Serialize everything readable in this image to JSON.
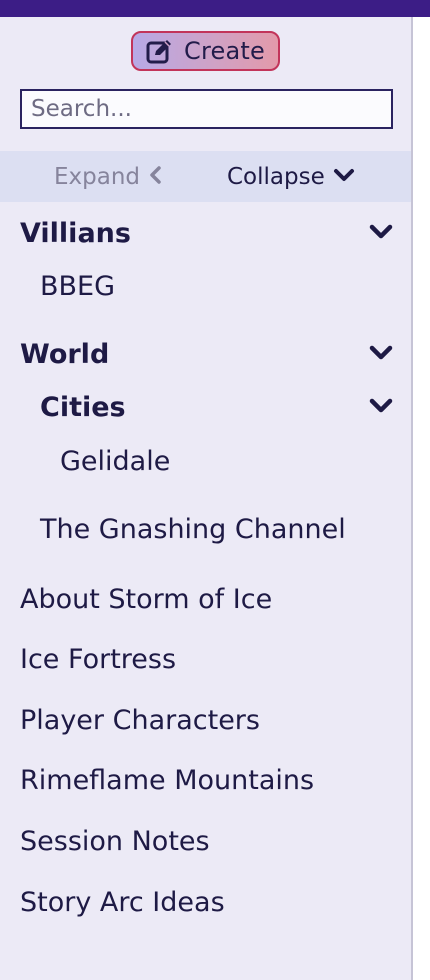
{
  "create_button": {
    "label": "Create",
    "icon": "edit-icon"
  },
  "search": {
    "placeholder": "Search..."
  },
  "tree_controls": {
    "expand_label": "Expand",
    "collapse_label": "Collapse"
  },
  "tree": {
    "villians": {
      "label": "Villians",
      "children": [
        {
          "label": "BBEG"
        }
      ]
    },
    "world": {
      "label": "World",
      "cities": {
        "label": "Cities",
        "children": [
          {
            "label": "Gelidale"
          }
        ]
      },
      "children": [
        {
          "label": "The Gnashing Channel"
        }
      ]
    },
    "pages": [
      {
        "label": "About Storm of Ice"
      },
      {
        "label": "Ice Fortress"
      },
      {
        "label": "Player Characters"
      },
      {
        "label": "Rimeflame Mountains"
      },
      {
        "label": "Session Notes"
      },
      {
        "label": "Story Arc Ideas"
      }
    ]
  },
  "colors": {
    "header": "#3c1d86",
    "sidebar_bg": "#eceaf6",
    "toggle_bar_bg": "#dcdff2",
    "text": "#1e1a45",
    "muted_text": "#86849c",
    "create_border": "#c2345a"
  }
}
